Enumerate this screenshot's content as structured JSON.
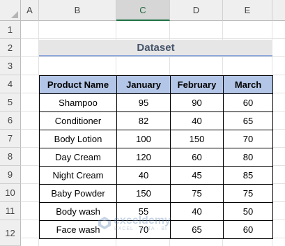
{
  "columns": [
    {
      "letter": "A",
      "selected": false
    },
    {
      "letter": "B",
      "selected": false
    },
    {
      "letter": "C",
      "selected": true
    },
    {
      "letter": "D",
      "selected": false
    },
    {
      "letter": "E",
      "selected": false
    }
  ],
  "rows": [
    "1",
    "2",
    "3",
    "4",
    "5",
    "6",
    "7",
    "8",
    "9",
    "10",
    "11",
    "12"
  ],
  "title": "Dataset",
  "table": {
    "headers": [
      "Product Name",
      "January",
      "February",
      "March"
    ],
    "rows": [
      [
        "Shampoo",
        "95",
        "90",
        "60"
      ],
      [
        "Conditioner",
        "82",
        "40",
        "65"
      ],
      [
        "Body Lotion",
        "100",
        "150",
        "70"
      ],
      [
        "Day Cream",
        "120",
        "60",
        "80"
      ],
      [
        "Night Cream",
        "40",
        "45",
        "85"
      ],
      [
        "Baby Powder",
        "150",
        "75",
        "75"
      ],
      [
        "Body wash",
        "55",
        "40",
        "50"
      ],
      [
        "Face wash",
        "70",
        "65",
        "60"
      ]
    ]
  },
  "watermark": {
    "name": "exceldemy",
    "tagline": "EXCEL · DATA · BI"
  },
  "colors": {
    "header_fill": "#b4c6e7",
    "title_fill": "#e7e6e6",
    "title_text": "#44546a",
    "title_underline": "#8ea9db",
    "selected_column": "#217346"
  }
}
